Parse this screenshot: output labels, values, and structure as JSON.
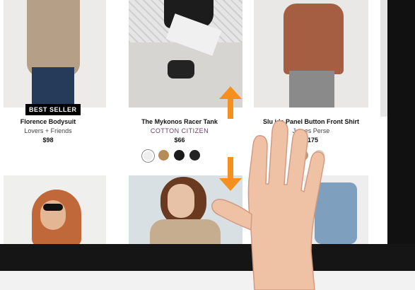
{
  "products": [
    {
      "title": "Florence Bodysuit",
      "brand": "Lovers + Friends",
      "price": "$98",
      "badge": "BEST SELLER"
    },
    {
      "title": "The Mykonos Racer Tank",
      "brand": "COTTON CITIZEN",
      "price": "$66",
      "swatches": [
        "#eeeeee",
        "#b58b5a",
        "#1b1b1b",
        "#222222"
      ]
    },
    {
      "title": "Slu   ide Panel Button Front Shirt",
      "brand": "James Perse",
      "price": "$175",
      "swatches": [
        "#b89a79",
        "#d8d2c8"
      ]
    }
  ],
  "colors": {
    "arrow": "#f5901e",
    "badge_bg": "#000000",
    "brand_accent": "#6d3b6b"
  },
  "icons": [
    "arrow-up-icon",
    "arrow-down-icon",
    "hand-gesture-icon"
  ]
}
